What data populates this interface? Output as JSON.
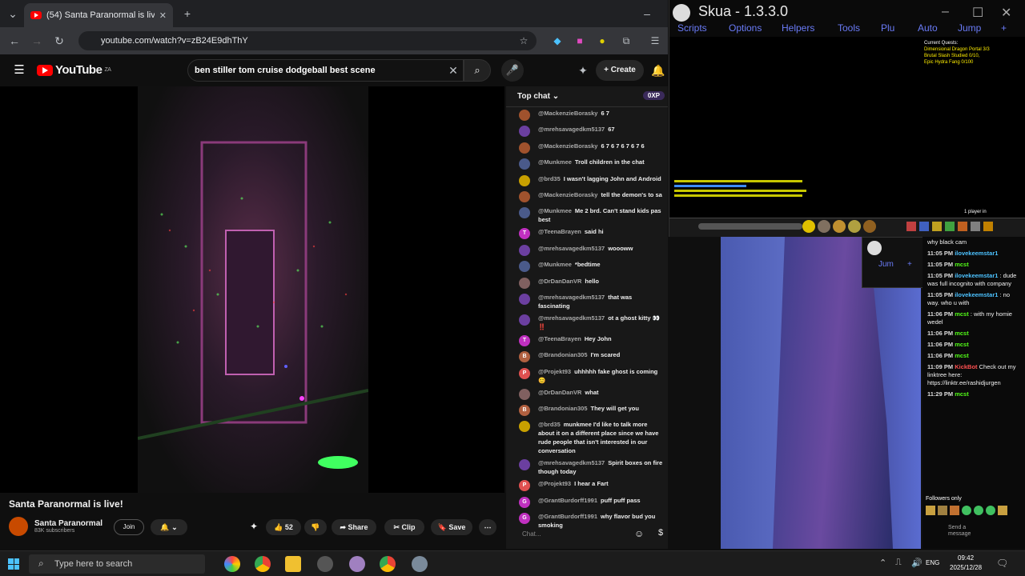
{
  "browser": {
    "tab_title": "(54) Santa Paranormal is live!",
    "url": "youtube.com/watch?v=zB24E9dhThY"
  },
  "youtube": {
    "logo": "YouTube",
    "logo_region": "ZA",
    "search_value": "ben stiller tom cruise dodgeball best scene",
    "create_label": "Create",
    "video_title": "Santa Paranormal is live!",
    "channel_name": "Santa Paranormal",
    "channel_subs": "83K subscribers",
    "join_label": "Join",
    "like_count": "52",
    "share_label": "Share",
    "clip_label": "Clip",
    "save_label": "Save"
  },
  "chat": {
    "header": "Top chat",
    "xp_badge": "0XP",
    "input_placeholder": "Chat...",
    "messages": [
      {
        "author": "@MackenzieBorasky",
        "text": "6 7",
        "color": "#a0522d",
        "initial": ""
      },
      {
        "author": "@mrehsavagedkm5137",
        "text": "67",
        "color": "#6b3fa0",
        "initial": ""
      },
      {
        "author": "@MackenzieBorasky",
        "text": "6 7 6 7 6 7 6 7 6",
        "color": "#a0522d",
        "initial": ""
      },
      {
        "author": "@Munkmee",
        "text": "Troll children in the chat",
        "color": "#4a5a8a",
        "initial": ""
      },
      {
        "author": "@brd35",
        "text": "I wasn't lagging John and Android",
        "color": "#c8a000",
        "initial": ""
      },
      {
        "author": "@MackenzieBorasky",
        "text": "tell the demon's to sa",
        "color": "#a0522d",
        "initial": ""
      },
      {
        "author": "@Munkmee",
        "text": "Me 2 brd. Can't stand kids pas best",
        "color": "#4a5a8a",
        "initial": ""
      },
      {
        "author": "@TeenaBrayen",
        "text": "said hi",
        "color": "#c030c0",
        "initial": "T"
      },
      {
        "author": "@mrehsavagedkm5137",
        "text": "woooww",
        "color": "#6b3fa0",
        "initial": ""
      },
      {
        "author": "@Munkmee",
        "text": "*bedtime",
        "color": "#4a5a8a",
        "initial": ""
      },
      {
        "author": "@DrDanDanVR",
        "text": "hello",
        "color": "#806060",
        "initial": ""
      },
      {
        "author": "@mrehsavagedkm5137",
        "text": "that was fascinating",
        "color": "#6b3fa0",
        "initial": ""
      },
      {
        "author": "@mrehsavagedkm5137",
        "text": "ot a ghost kitty 👀 ‼️",
        "color": "#6b3fa0",
        "initial": ""
      },
      {
        "author": "@TeenaBrayen",
        "text": "Hey John",
        "color": "#c030c0",
        "initial": "T"
      },
      {
        "author": "@Brandonian305",
        "text": "I'm scared",
        "color": "#b06040",
        "initial": "B"
      },
      {
        "author": "@Projekt93",
        "text": "uhhhhh fake ghost is coming 😊",
        "color": "#e05050",
        "initial": "P"
      },
      {
        "author": "@DrDanDanVR",
        "text": "what",
        "color": "#806060",
        "initial": ""
      },
      {
        "author": "@Brandonian305",
        "text": "They will get you",
        "color": "#b06040",
        "initial": "B"
      },
      {
        "author": "@brd35",
        "text": "munkmee I'd like to talk more about it on a different place since we have rude people that isn't interested in our conversation",
        "color": "#c8a000",
        "initial": ""
      },
      {
        "author": "@mrehsavagedkm5137",
        "text": "Spirit boxes on fire though today",
        "color": "#6b3fa0",
        "initial": ""
      },
      {
        "author": "@Projekt93",
        "text": "I hear a Fart",
        "color": "#e05050",
        "initial": "P"
      },
      {
        "author": "@GrantBurdorff1991",
        "text": "puff puff pass",
        "color": "#c030c0",
        "initial": "G"
      },
      {
        "author": "@GrantBurdorff1991",
        "text": "why flavor bud you smoking",
        "color": "#c030c0",
        "initial": "G"
      }
    ]
  },
  "skua": {
    "title": "Skua - 1.3.3.0",
    "menu": [
      "Scripts",
      "Options",
      "Helpers",
      "Tools",
      "Plu",
      "Auto",
      "Jump"
    ],
    "quest_title": "Current Quests:",
    "quests": [
      "Dimensional Dragon Portal 3/3",
      "Brutal Slash Studied 0/10,",
      "Epic Hydra Fang 0/100"
    ],
    "status": "1 player in"
  },
  "kick_chat": {
    "messages": [
      {
        "time": "",
        "user": "",
        "text": "why black cam"
      },
      {
        "time": "11:05 PM",
        "user": "ilovekeemstar1",
        "text": ""
      },
      {
        "time": "11:05 PM",
        "user": "mcst",
        "text": ""
      },
      {
        "time": "11:05 PM",
        "user": "ilovekeemstar1",
        "text": ": dude was full incognito with company"
      },
      {
        "time": "11:05 PM",
        "user": "ilovekeemstar1",
        "text": ": no way. who u with"
      },
      {
        "time": "11:06 PM",
        "user": "mcst",
        "text": ": with my homie wedel"
      },
      {
        "time": "11:06 PM",
        "user": "mcst",
        "text": ""
      },
      {
        "time": "11:06 PM",
        "user": "mcst",
        "text": ""
      },
      {
        "time": "11:06 PM",
        "user": "mcst",
        "text": ""
      },
      {
        "time": "11:09 PM",
        "user": "KickBot",
        "text": "Check out my linktree here: https://linktr.ee/rashidjurgen"
      },
      {
        "time": "11:29 PM",
        "user": "mcst",
        "text": ""
      }
    ],
    "followers_only": "Followers only",
    "send_placeholder": "Send a message"
  },
  "taskbar": {
    "search_placeholder": "Type here to search",
    "lang": "ENG",
    "time": "09:42",
    "date": "2025/12/28"
  }
}
